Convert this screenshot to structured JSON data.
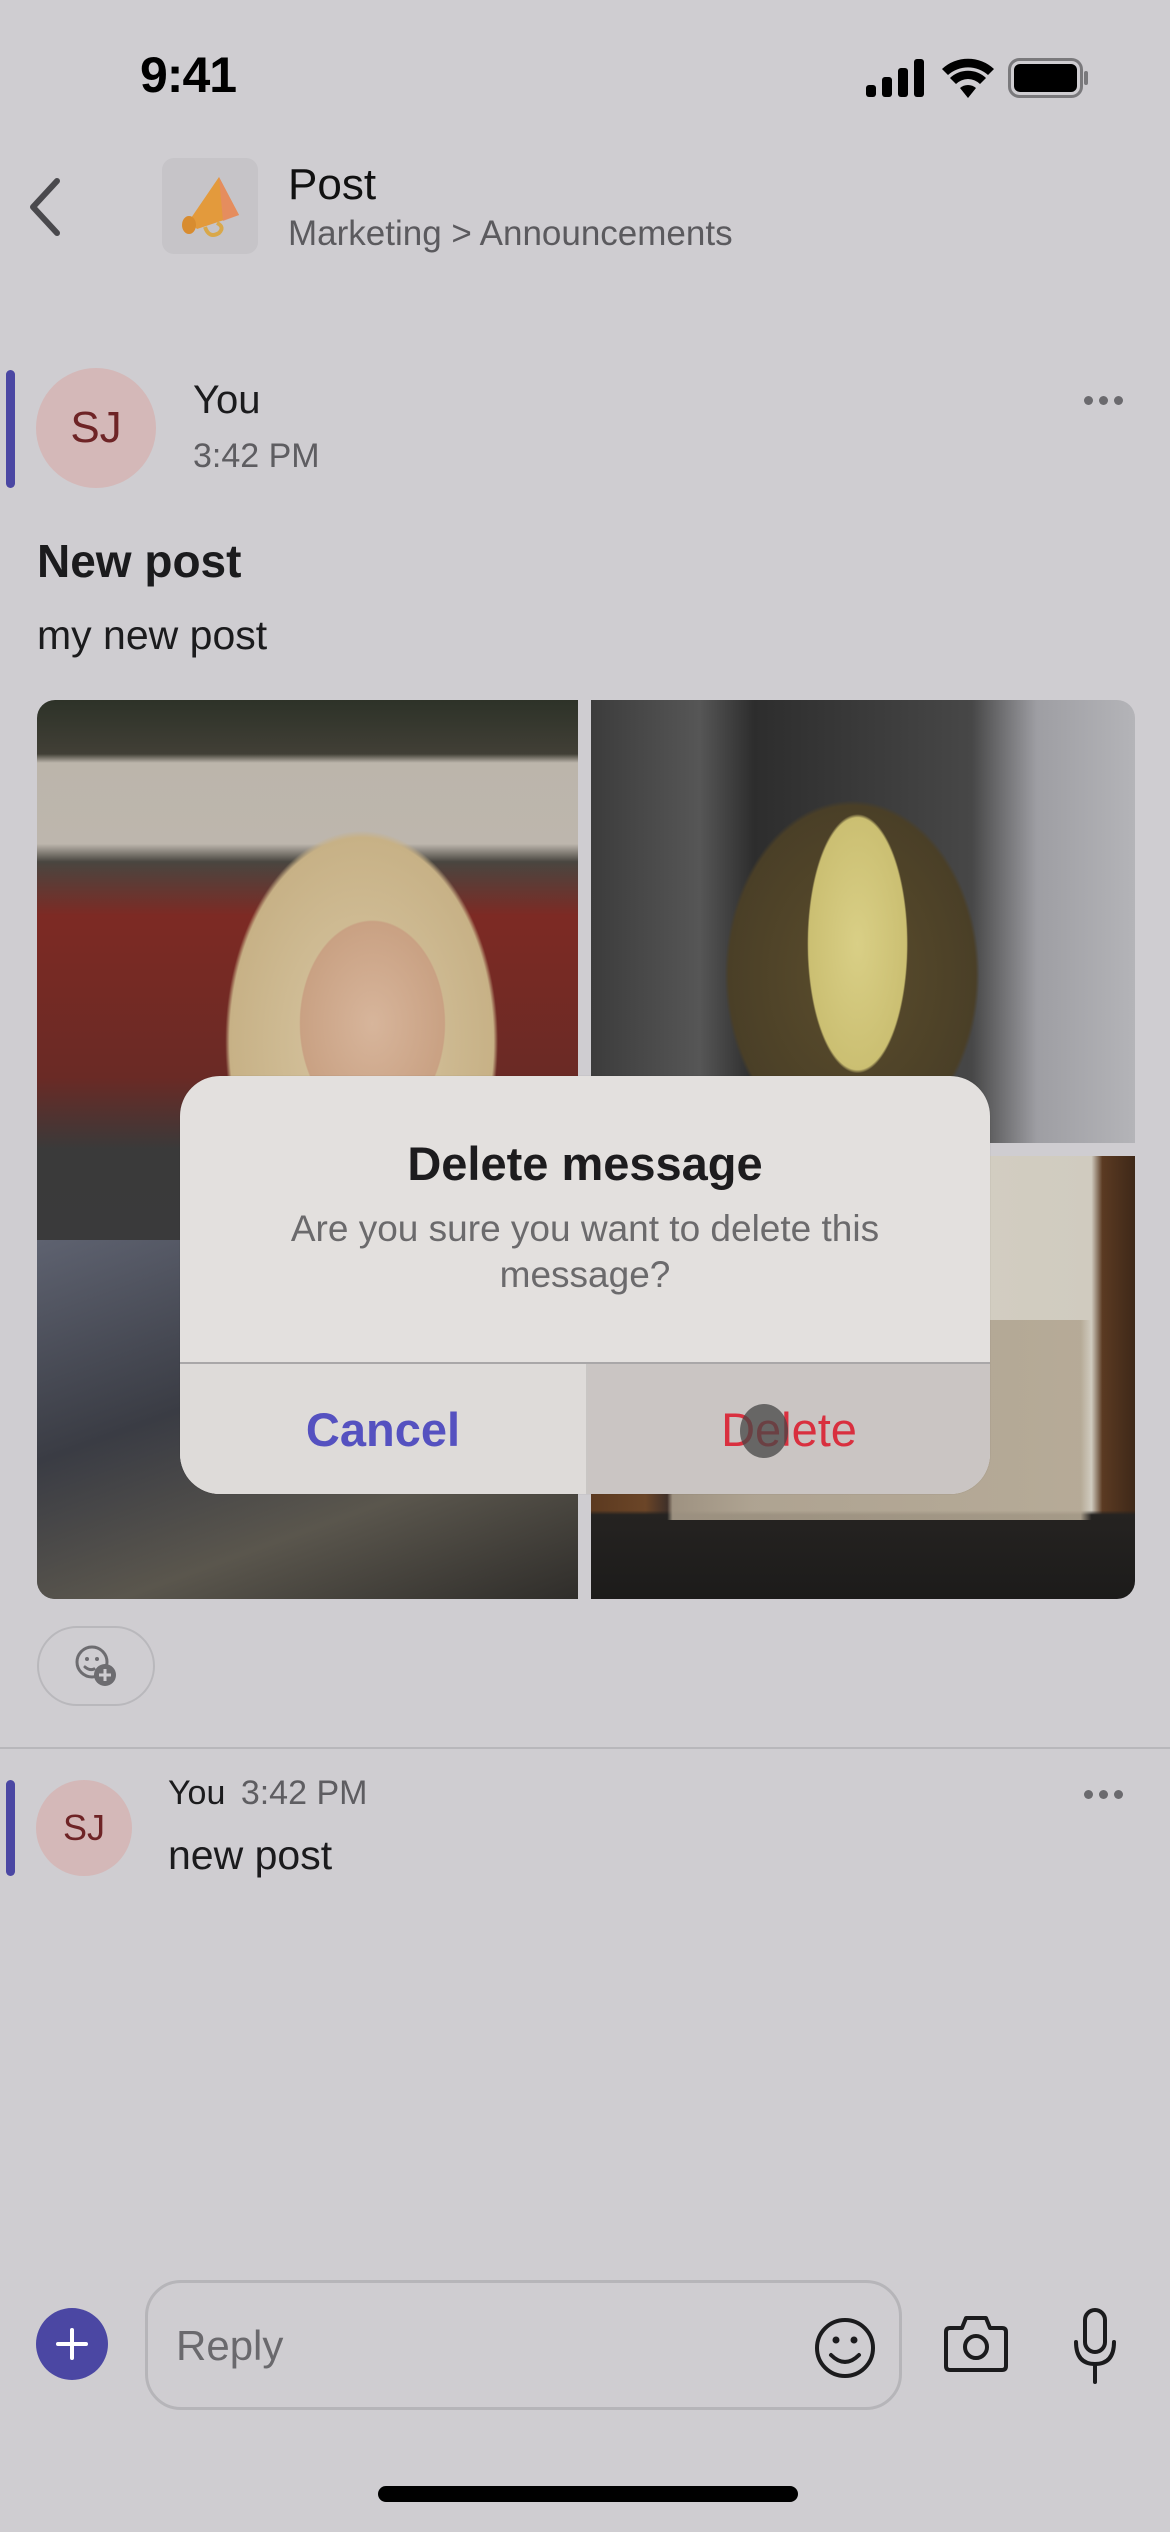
{
  "status_bar": {
    "time": "9:41",
    "icons": [
      "cellular-signal-icon",
      "wifi-icon",
      "battery-icon"
    ]
  },
  "header": {
    "back_icon": "chevron-left-icon",
    "channel_icon": "megaphone-icon",
    "title": "Post",
    "breadcrumb": "Marketing > Announcements"
  },
  "messages": [
    {
      "avatar_initials": "SJ",
      "author": "You",
      "time": "3:42 PM",
      "title": "New post",
      "body": "my new post",
      "images": [
        "photo-woman-blonde-portrait",
        "photo-woman-plaid-blazer",
        "photo-woman-doorway"
      ],
      "reaction_button": "add-reaction-icon",
      "more_icon": "more-horizontal-icon"
    },
    {
      "avatar_initials": "SJ",
      "author": "You",
      "time": "3:42 PM",
      "body": "new post",
      "more_icon": "more-horizontal-icon"
    }
  ],
  "composer": {
    "plus_icon": "plus-icon",
    "placeholder": "Reply",
    "value": "",
    "emoji_icon": "emoji-icon",
    "camera_icon": "camera-icon",
    "mic_icon": "microphone-icon"
  },
  "alert": {
    "title": "Delete message",
    "message": "Are you sure you want to delete this message?",
    "cancel_label": "Cancel",
    "delete_label": "Delete"
  },
  "colors": {
    "background": "#cfcdd1",
    "accent": "#4b47a3",
    "cancel": "#5551c0",
    "destructive": "#d9303f",
    "avatar_bg": "#d4b8b8",
    "avatar_text": "#6e2426"
  }
}
